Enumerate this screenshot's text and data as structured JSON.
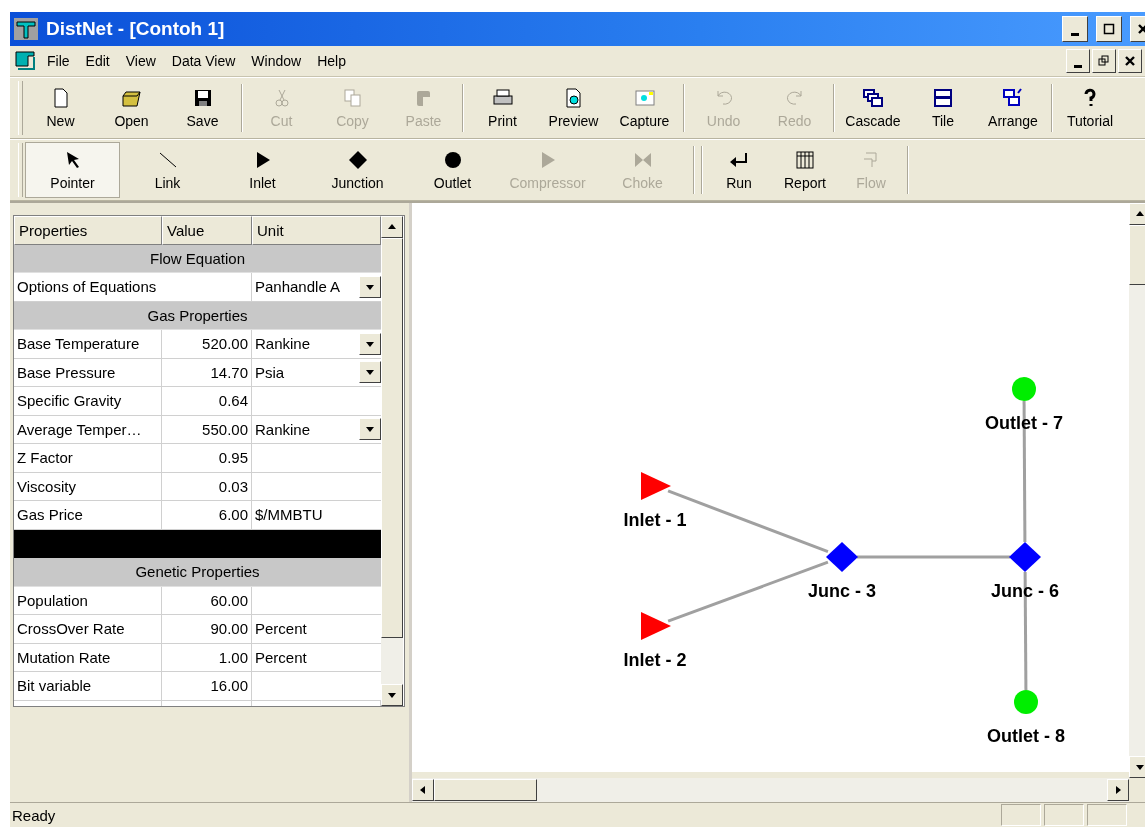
{
  "window": {
    "title": "DistNet  - [Contoh 1]"
  },
  "menu": [
    "File",
    "Edit",
    "View",
    "Data View",
    "Window",
    "Help"
  ],
  "toolbar": [
    [
      {
        "label": "New",
        "kind": "new",
        "disabled": false
      },
      {
        "label": "Open",
        "kind": "open",
        "disabled": false
      },
      {
        "label": "Save",
        "kind": "save",
        "disabled": false
      }
    ],
    [
      {
        "label": "Cut",
        "kind": "cut",
        "disabled": true
      },
      {
        "label": "Copy",
        "kind": "copy",
        "disabled": true
      },
      {
        "label": "Paste",
        "kind": "paste",
        "disabled": true
      }
    ],
    [
      {
        "label": "Print",
        "kind": "print",
        "disabled": false
      },
      {
        "label": "Preview",
        "kind": "preview",
        "disabled": false
      },
      {
        "label": "Capture",
        "kind": "capture",
        "disabled": false
      }
    ],
    [
      {
        "label": "Undo",
        "kind": "undo",
        "disabled": true
      },
      {
        "label": "Redo",
        "kind": "redo",
        "disabled": true
      }
    ],
    [
      {
        "label": "Cascade",
        "kind": "cascade",
        "disabled": false
      },
      {
        "label": "Tile",
        "kind": "tile",
        "disabled": false
      },
      {
        "label": "Arrange",
        "kind": "arrange",
        "disabled": false
      }
    ],
    [
      {
        "label": "Tutorial",
        "kind": "help",
        "disabled": false
      }
    ]
  ],
  "tools": [
    [
      {
        "label": "Pointer",
        "kind": "pointer",
        "disabled": false,
        "selected": true
      },
      {
        "label": "Link",
        "kind": "link",
        "disabled": false,
        "selected": false
      },
      {
        "label": "Inlet",
        "kind": "inlet",
        "disabled": false,
        "selected": false
      },
      {
        "label": "Junction",
        "kind": "junction",
        "disabled": false,
        "selected": false
      },
      {
        "label": "Outlet",
        "kind": "outlet",
        "disabled": false,
        "selected": false
      },
      {
        "label": "Compressor",
        "kind": "compressor",
        "disabled": true,
        "selected": false
      },
      {
        "label": "Choke",
        "kind": "choke",
        "disabled": true,
        "selected": false
      }
    ],
    [
      {
        "label": "Run",
        "kind": "run",
        "disabled": false,
        "selected": false
      },
      {
        "label": "Report",
        "kind": "report",
        "disabled": false,
        "selected": false
      },
      {
        "label": "Flow",
        "kind": "flow",
        "disabled": true,
        "selected": false
      }
    ]
  ],
  "properties": {
    "columns": [
      "Properties",
      "Value",
      "Unit"
    ],
    "rows": [
      {
        "kind": "section",
        "name": "Flow Equation"
      },
      {
        "kind": "wide",
        "name": "Options of Equations",
        "unit": "Panhandle A",
        "dropdown": true
      },
      {
        "kind": "section",
        "name": "Gas Properties"
      },
      {
        "kind": "row",
        "name": "Base Temperature",
        "value": "520.00",
        "unit": "Rankine",
        "dropdown": true
      },
      {
        "kind": "row",
        "name": "Base Pressure",
        "value": "14.70",
        "unit": "Psia",
        "dropdown": true
      },
      {
        "kind": "row",
        "name": "Specific Gravity",
        "value": "0.64"
      },
      {
        "kind": "row",
        "name": "Average Temper…",
        "value": "550.00",
        "unit": "Rankine",
        "dropdown": true
      },
      {
        "kind": "row",
        "name": "Z Factor",
        "value": "0.95"
      },
      {
        "kind": "row",
        "name": "Viscosity",
        "value": "0.03"
      },
      {
        "kind": "row",
        "name": "Gas Price",
        "value": "6.00",
        "unit": "$/MMBTU"
      },
      {
        "kind": "blank"
      },
      {
        "kind": "section",
        "name": "Genetic Properties"
      },
      {
        "kind": "row",
        "name": "Population",
        "value": "60.00"
      },
      {
        "kind": "row",
        "name": "CrossOver Rate",
        "value": "90.00",
        "unit": "Percent"
      },
      {
        "kind": "row",
        "name": "Mutation Rate",
        "value": "1.00",
        "unit": "Percent"
      },
      {
        "kind": "row",
        "name": "Bit variable",
        "value": "16.00"
      }
    ]
  },
  "network": {
    "nodes": [
      {
        "kind": "outlet",
        "label": "Outlet - 7",
        "color": "#00ee00"
      },
      {
        "kind": "inlet",
        "label": "Inlet - 1",
        "color": "#ff0000"
      },
      {
        "kind": "junction",
        "label": "Junc - 3",
        "color": "#0000ff"
      },
      {
        "kind": "junction",
        "label": "Junc - 6",
        "color": "#0000ff"
      },
      {
        "kind": "inlet",
        "label": "Inlet - 2",
        "color": "#ff0000"
      },
      {
        "kind": "outlet",
        "label": "Outlet - 8",
        "color": "#00ee00"
      }
    ]
  },
  "status_bar": {
    "text": "Ready"
  }
}
